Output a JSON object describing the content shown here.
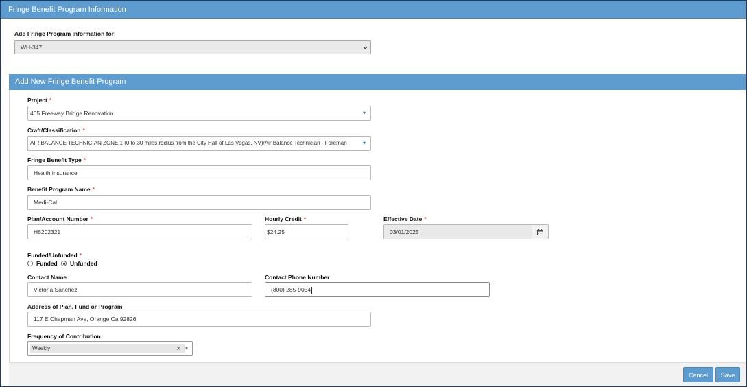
{
  "header": {
    "title": "Fringe Benefit Program Information"
  },
  "add_for": {
    "label": "Add Fringe Program Information for:",
    "value": "WH-347"
  },
  "section": {
    "title": "Add New Fringe Benefit Program"
  },
  "form": {
    "project": {
      "label": "Project",
      "value": "405 Freeway Bridge Renovation"
    },
    "craft": {
      "label": "Craft/Classification",
      "value": "AIR BALANCE TECHNICIAN ZONE 1 (0 to 30 miles radius from the City Hall of Las Vegas, NV)/Air Balance Technician - Foreman"
    },
    "benefit_type": {
      "label": "Fringe Benefit Type",
      "value": "Health insurance"
    },
    "program_name": {
      "label": "Benefit Program Name",
      "value": "Medi-Cal"
    },
    "plan_number": {
      "label": "Plan/Account Number",
      "value": "H6202321"
    },
    "hourly_credit": {
      "label": "Hourly Credit",
      "value": "$24.25"
    },
    "effective_date": {
      "label": "Effective Date",
      "value": "03/01/2025"
    },
    "funded": {
      "label": "Funded/Unfunded",
      "options": [
        "Funded",
        "Unfunded"
      ],
      "selected": "Unfunded"
    },
    "contact_name": {
      "label": "Contact Name",
      "value": "Victoria Sanchez"
    },
    "contact_phone": {
      "label": "Contact Phone Number",
      "value": "(800) 285-9054"
    },
    "address": {
      "label": "Address of Plan, Fund or Program",
      "value": "117 E Chapman Ave, Orange Ca 92826"
    },
    "frequency": {
      "label": "Frequency of Contribution",
      "value": "Weekly",
      "clear_glyph": "×",
      "caret_glyph": "▾"
    },
    "required_marker": "*"
  },
  "buttons": {
    "cancel": "Cancel",
    "save": "Save"
  },
  "icons": {
    "dropdown_caret": "caret-down-icon",
    "calendar": "calendar-icon",
    "chevron": "chevron-down-icon"
  },
  "colors": {
    "accent": "#5e9ccf",
    "required": "#d9534f"
  }
}
